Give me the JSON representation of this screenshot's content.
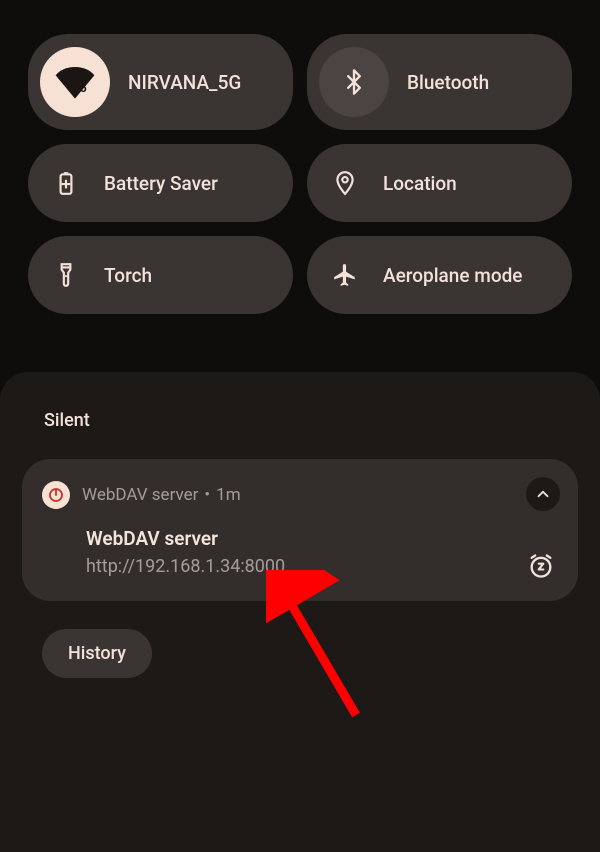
{
  "qs": {
    "wifi": {
      "label": "NIRVANA_5G"
    },
    "bluetooth": {
      "label": "Bluetooth"
    },
    "battery": {
      "label": "Battery Saver"
    },
    "location": {
      "label": "Location"
    },
    "torch": {
      "label": "Torch"
    },
    "airplane": {
      "label": "Aeroplane mode"
    }
  },
  "notifications": {
    "section_label": "Silent",
    "card": {
      "app_name": "WebDAV server",
      "time": "1m",
      "separator": " • ",
      "title": "WebDAV server",
      "text": "http://192.168.1.34:8000"
    },
    "history_label": "History"
  }
}
